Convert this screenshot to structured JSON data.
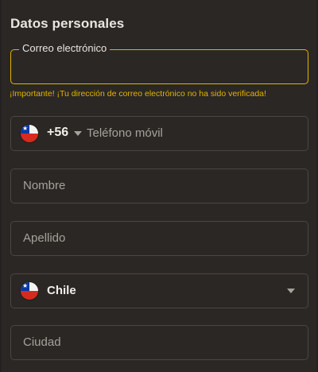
{
  "section": {
    "title": "Datos personales"
  },
  "email": {
    "label": "Correo electrónico",
    "value": "",
    "warning": "¡Importante! ¡Tu dirección de correo electrónico no ha sido verificada!"
  },
  "phone": {
    "flag_icon": "chile-flag-icon",
    "dial_code": "+56",
    "placeholder": "Teléfono móvil"
  },
  "first_name": {
    "placeholder": "Nombre"
  },
  "last_name": {
    "placeholder": "Apellido"
  },
  "country": {
    "flag_icon": "chile-flag-icon",
    "selected": "Chile"
  },
  "city": {
    "placeholder": "Ciudad"
  },
  "colors": {
    "background": "#2b2724",
    "accent": "#e3b400",
    "border": "#4b4642",
    "text": "#e9e6e1",
    "placeholder": "#a6a19b"
  }
}
